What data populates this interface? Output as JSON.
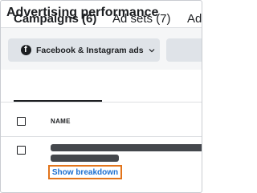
{
  "page": {
    "title": "Advertising performance"
  },
  "filters": {
    "platform_label": "Facebook & Instagram ads",
    "platform_icon": "facebook-icon"
  },
  "tabs": [
    {
      "label": "Campaigns (6)",
      "active": true
    },
    {
      "label": "Ad sets (7)",
      "active": false
    },
    {
      "label": "Ad",
      "active": false
    }
  ],
  "table": {
    "columns": [
      "NAME"
    ]
  },
  "row": {
    "action_label": "Show breakdown"
  },
  "colors": {
    "highlight": "#e2741b",
    "link": "#1b6fd1"
  }
}
